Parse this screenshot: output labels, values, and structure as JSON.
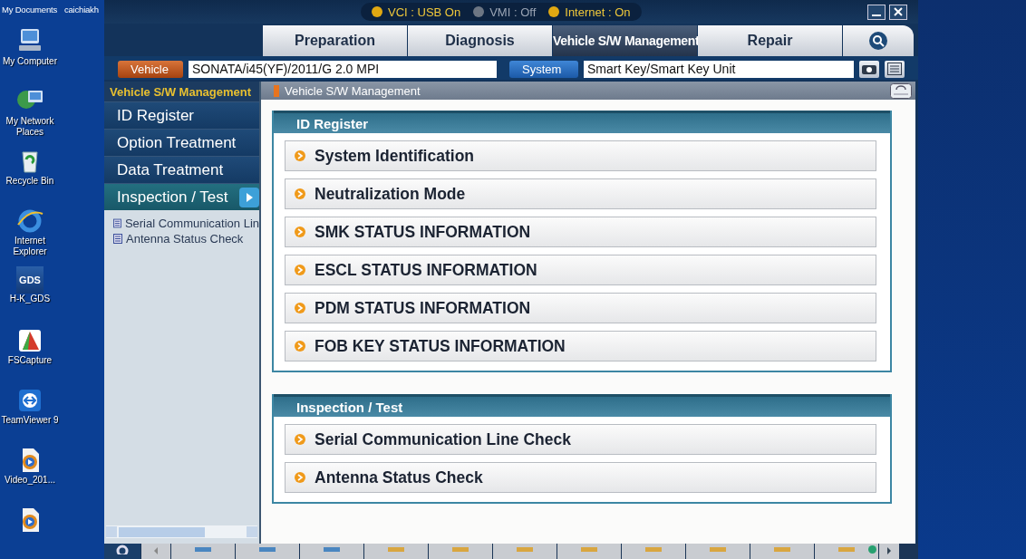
{
  "desktop": {
    "top_labels": [
      "My Documents",
      "caichiakh"
    ],
    "icons": [
      {
        "kind": "computer",
        "label": "My Computer"
      },
      {
        "kind": "network",
        "label": "My Network Places"
      },
      {
        "kind": "recycle",
        "label": "Recycle Bin"
      },
      {
        "kind": "browser",
        "label": "Internet Explorer"
      },
      {
        "kind": "gds",
        "label": "H-K_GDS",
        "icon_text": "GDS"
      },
      {
        "kind": "capture",
        "label": "FSCapture"
      },
      {
        "kind": "remote",
        "label": "TeamViewer 9"
      },
      {
        "kind": "video",
        "label": "Video_201..."
      },
      {
        "kind": "video"
      }
    ]
  },
  "status": [
    {
      "label": "VCI : USB On",
      "on": true
    },
    {
      "label": "VMI : Off",
      "on": false
    },
    {
      "label": "Internet : On",
      "on": true
    }
  ],
  "tabs": [
    {
      "label": "Preparation",
      "selected": false
    },
    {
      "label": "Diagnosis",
      "selected": false
    },
    {
      "label": "Vehicle S/W Management",
      "selected": true
    },
    {
      "label": "Repair",
      "selected": false
    }
  ],
  "vehicle": {
    "button": "Vehicle",
    "value": "SONATA/i45(YF)/2011/G 2.0 MPI"
  },
  "system": {
    "button": "System",
    "value": "Smart Key/Smart Key Unit"
  },
  "sidebar": {
    "title": "Vehicle S/W Management",
    "items": [
      {
        "label": "ID Register",
        "selected": false
      },
      {
        "label": "Option Treatment",
        "selected": false
      },
      {
        "label": "Data Treatment",
        "selected": false
      },
      {
        "label": "Inspection / Test",
        "selected": true
      }
    ],
    "subitems": [
      "Serial Communication Lin",
      "Antenna Status Check"
    ]
  },
  "content": {
    "title": "Vehicle S/W Management",
    "groups": [
      {
        "title": "ID Register",
        "items": [
          "System Identification",
          "Neutralization Mode",
          "SMK STATUS INFORMATION",
          "ESCL STATUS INFORMATION",
          "PDM STATUS INFORMATION",
          "FOB KEY STATUS INFORMATION"
        ]
      },
      {
        "title": "Inspection / Test",
        "items": [
          "Serial Communication Line Check",
          "Antenna Status Check"
        ]
      }
    ]
  },
  "toolbar": {
    "buttons": [
      {
        "color": "#4a86c0",
        "badge": false
      },
      {
        "color": "#4a86c0",
        "badge": false
      },
      {
        "color": "#4a86c0",
        "badge": false
      },
      {
        "color": "#d9a640",
        "badge": false
      },
      {
        "color": "#d9a640",
        "badge": false
      },
      {
        "color": "#d9a640",
        "badge": false
      },
      {
        "color": "#d9a640",
        "badge": false
      },
      {
        "color": "#d9a640",
        "badge": false
      },
      {
        "color": "#d9a640",
        "badge": false
      },
      {
        "color": "#d9a640",
        "badge": false
      },
      {
        "color": "#d9a640",
        "badge": true
      }
    ]
  }
}
